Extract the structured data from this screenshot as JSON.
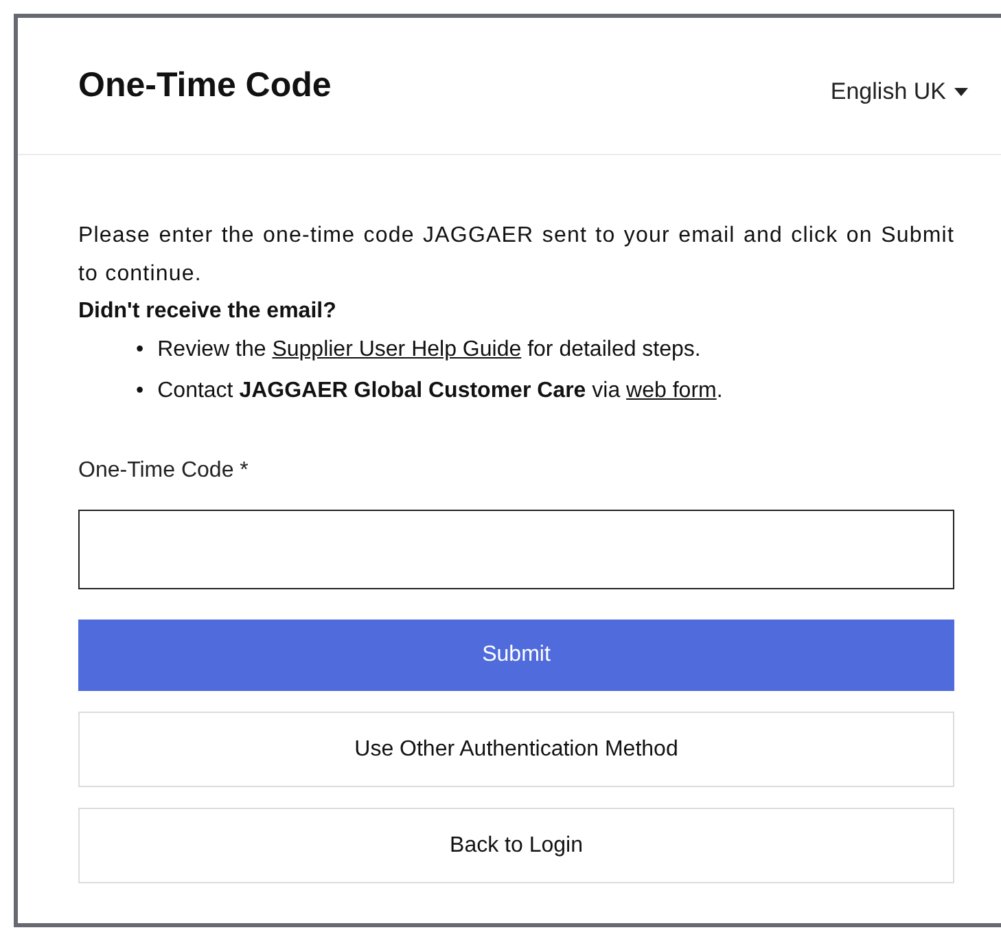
{
  "header": {
    "title": "One-Time Code",
    "language": "English UK"
  },
  "intro": "Please enter the one-time code JAGGAER sent to your email and click on Submit to continue.",
  "help_heading": "Didn't receive the email?",
  "help_items": [
    {
      "marker": "•",
      "parts": [
        {
          "kind": "text",
          "text": "Review the "
        },
        {
          "kind": "link",
          "text": "Supplier User Help Guide"
        },
        {
          "kind": "text",
          "text": " for detailed steps."
        }
      ]
    },
    {
      "marker": "•",
      "parts": [
        {
          "kind": "text",
          "text": "Contact **JAGGAER Global Customer Care** via "
        },
        {
          "kind": "link",
          "text": "web form"
        },
        {
          "kind": "text",
          "text": "."
        }
      ]
    }
  ],
  "field": {
    "label": "One-Time Code *"
  },
  "buttons": [
    {
      "label": "Submit",
      "kind": "primary"
    },
    {
      "label": "Use Other Authentication Method",
      "kind": "secondary"
    },
    {
      "label": "Back to Login",
      "kind": "secondary"
    }
  ]
}
